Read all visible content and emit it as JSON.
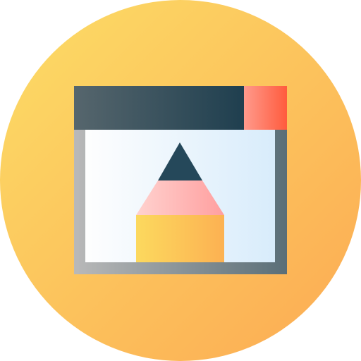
{
  "icon": {
    "name": "design-app-window-pencil-icon",
    "colors": {
      "circle_start": "#fcdd66",
      "circle_end": "#fcaa53",
      "titlebar_start": "#56666d",
      "titlebar_end": "#1f3f4f",
      "close_start": "#ff9a8c",
      "close_end": "#ff5b3d",
      "frame_start": "#b9b9b9",
      "frame_end": "#5a6e77",
      "canvas_start": "#fefefe",
      "canvas_end": "#d8ecfb",
      "pencil_tip": "#25485a",
      "pencil_wood_start": "#ffd2cf",
      "pencil_wood_end": "#ff9f9f",
      "pencil_body_start": "#fcd95e",
      "pencil_body_end": "#fcb152"
    }
  }
}
